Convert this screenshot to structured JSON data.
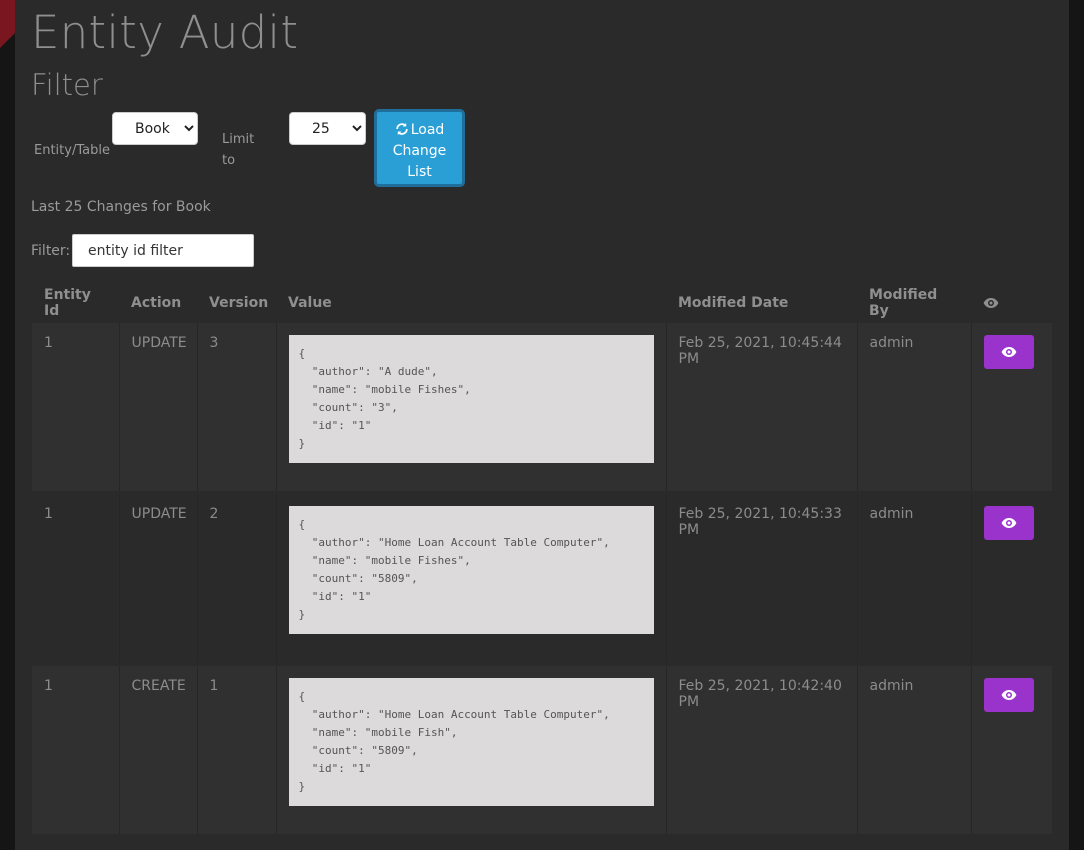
{
  "page": {
    "title": "Entity Audit",
    "subtitle": "Filter"
  },
  "controls": {
    "entity_label": "Entity/Table",
    "entity_selected": "Book",
    "limit_label": "Limit to",
    "limit_selected": "25",
    "load_button": "Load Change List",
    "load_icon": "refresh-icon"
  },
  "summary": "Last 25 Changes for Book",
  "filter": {
    "label": "Filter:",
    "placeholder": "entity id filter"
  },
  "table": {
    "headers": [
      "Entity Id",
      "Action",
      "Version",
      "Value",
      "Modified Date",
      "Modified By"
    ],
    "view_header_icon": "eye-icon",
    "rows": [
      {
        "entity_id": "1",
        "action": "UPDATE",
        "version": "3",
        "value": "{\n  \"author\": \"A dude\",\n  \"name\": \"mobile Fishes\",\n  \"count\": \"3\",\n  \"id\": \"1\"\n}",
        "modified_date": "Feb 25, 2021, 10:45:44 PM",
        "modified_by": "admin"
      },
      {
        "entity_id": "1",
        "action": "UPDATE",
        "version": "2",
        "value": "{\n  \"author\": \"Home Loan Account Table Computer\",\n  \"name\": \"mobile Fishes\",\n  \"count\": \"5809\",\n  \"id\": \"1\"\n}",
        "modified_date": "Feb 25, 2021, 10:45:33 PM",
        "modified_by": "admin"
      },
      {
        "entity_id": "1",
        "action": "CREATE",
        "version": "1",
        "value": "{\n  \"author\": \"Home Loan Account Table Computer\",\n  \"name\": \"mobile Fish\",\n  \"count\": \"5809\",\n  \"id\": \"1\"\n}",
        "modified_date": "Feb 25, 2021, 10:42:40 PM",
        "modified_by": "admin"
      }
    ]
  },
  "colors": {
    "background": "#2a2a2a",
    "load_button": "#2a9fd6",
    "view_button": "#9933cc",
    "code_bg": "#dcdada"
  }
}
